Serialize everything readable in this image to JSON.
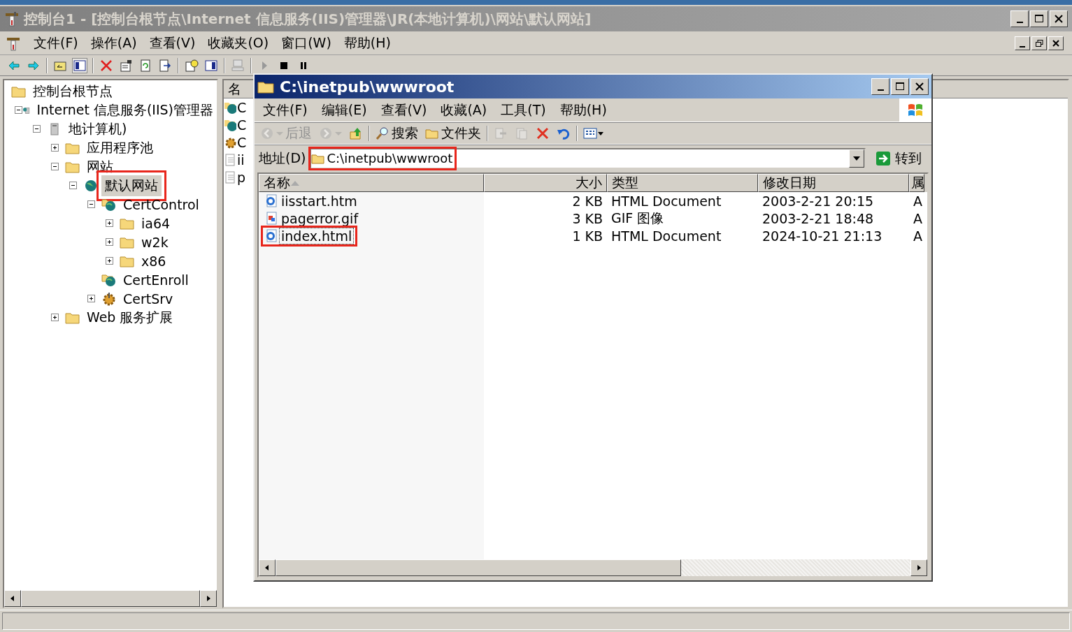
{
  "window": {
    "title": "控制台1 - [控制台根节点\\Internet 信息服务(IIS)管理器\\JR(本地计算机)\\网站\\默认网站]"
  },
  "menu": [
    "文件(F)",
    "操作(A)",
    "查看(V)",
    "收藏夹(O)",
    "窗口(W)",
    "帮助(H)"
  ],
  "tree": [
    {
      "label": "控制台根节点",
      "kind": "folder",
      "selected": false,
      "highlighted": false,
      "children": [
        {
          "label": "Internet 信息服务(IIS)管理器",
          "kind": "server",
          "expanded": true,
          "selected": false,
          "highlighted": false,
          "children": [
            {
              "label": "地计算机)",
              "kind": "computer",
              "expanded": true,
              "selected": false,
              "highlighted": false,
              "children": [
                {
                  "label": "应用程序池",
                  "kind": "folder",
                  "expanded": false,
                  "selected": false,
                  "highlighted": false
                },
                {
                  "label": "网站",
                  "kind": "folder",
                  "expanded": true,
                  "selected": false,
                  "highlighted": false,
                  "children": [
                    {
                      "label": "默认网站",
                      "kind": "globe",
                      "expanded": true,
                      "selected": true,
                      "highlighted": true,
                      "children": [
                        {
                          "label": "CertControl",
                          "kind": "webfolder",
                          "expanded": true,
                          "selected": false,
                          "highlighted": false,
                          "children": [
                            {
                              "label": "ia64",
                              "kind": "folder",
                              "expanded": false,
                              "selected": false,
                              "highlighted": false
                            },
                            {
                              "label": "w2k",
                              "kind": "folder",
                              "expanded": false,
                              "selected": false,
                              "highlighted": false
                            },
                            {
                              "label": "x86",
                              "kind": "folder",
                              "expanded": false,
                              "selected": false,
                              "highlighted": false
                            }
                          ]
                        },
                        {
                          "label": "CertEnroll",
                          "kind": "webfolder",
                          "selected": false,
                          "highlighted": false
                        },
                        {
                          "label": "CertSrv",
                          "kind": "gear",
                          "expanded": false,
                          "selected": false,
                          "highlighted": false
                        }
                      ]
                    }
                  ]
                },
                {
                  "label": "Web 服务扩展",
                  "kind": "folder",
                  "expanded": false,
                  "selected": false,
                  "highlighted": false
                }
              ]
            }
          ]
        }
      ]
    }
  ],
  "right_pane": {
    "column": "名",
    "items": [
      {
        "label": "C",
        "kind": "webfolder"
      },
      {
        "label": "C",
        "kind": "webfolder"
      },
      {
        "label": "C",
        "kind": "gear"
      },
      {
        "label": "ii",
        "kind": "file"
      },
      {
        "label": "p",
        "kind": "file"
      }
    ]
  },
  "explorer": {
    "title": "C:\\inetpub\\wwwroot",
    "menu": [
      "文件(F)",
      "编辑(E)",
      "查看(V)",
      "收藏(A)",
      "工具(T)",
      "帮助(H)"
    ],
    "toolbar": [
      {
        "kind": "back",
        "label": "后退",
        "disabled": true
      },
      {
        "kind": "forward",
        "disabled": true
      },
      {
        "kind": "up",
        "disabled": false
      },
      {
        "kind": "search",
        "label": "搜索",
        "disabled": false
      },
      {
        "kind": "folders",
        "label": "文件夹",
        "disabled": false
      },
      {
        "kind": "move",
        "disabled": true
      },
      {
        "kind": "copy",
        "disabled": true
      },
      {
        "kind": "delete",
        "disabled": false
      },
      {
        "kind": "undo",
        "disabled": false
      },
      {
        "kind": "views",
        "disabled": false
      }
    ],
    "address": {
      "label": "地址(D)",
      "value": "C:\\inetpub\\wwwroot",
      "highlighted": true,
      "go": "转到"
    },
    "columns": [
      "名称",
      "大小",
      "类型",
      "修改日期",
      "属"
    ],
    "rows": [
      {
        "name": "iisstart.htm",
        "kind": "html",
        "size": "2 KB",
        "type": "HTML Document",
        "date": "2003-2-21 20:15",
        "attr": "A",
        "focused": false,
        "highlighted": false
      },
      {
        "name": "pagerror.gif",
        "kind": "image",
        "size": "3 KB",
        "type": "GIF 图像",
        "date": "2003-2-21 18:48",
        "attr": "A",
        "focused": false,
        "highlighted": false
      },
      {
        "name": "index.html",
        "kind": "html",
        "size": "1 KB",
        "type": "HTML Document",
        "date": "2024-10-21 21:13",
        "attr": "A",
        "focused": true,
        "highlighted": true
      }
    ]
  }
}
